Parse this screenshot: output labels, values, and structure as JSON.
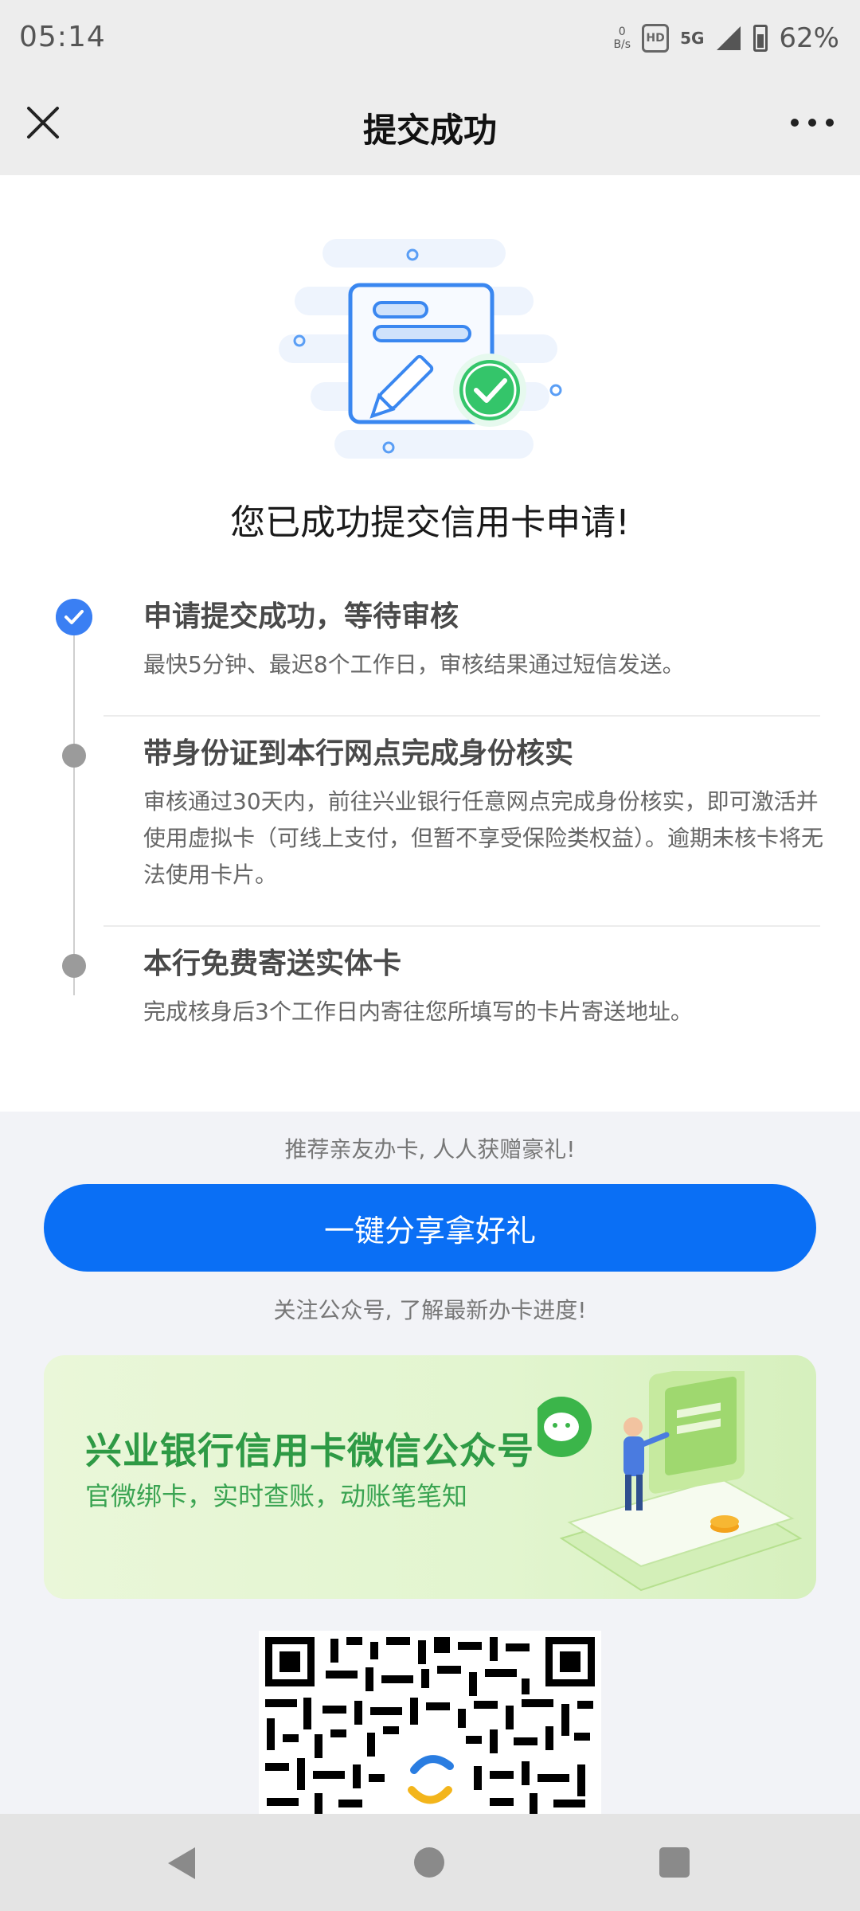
{
  "status_bar": {
    "time": "05:14",
    "net_speed_value": "0",
    "net_speed_unit": "B/s",
    "hd_label": "HD",
    "network": "5G",
    "battery": "62%"
  },
  "nav": {
    "title": "提交成功",
    "close_icon": "close-icon",
    "more_icon": "more-icon"
  },
  "success_message": "您已成功提交信用卡申请!",
  "steps": [
    {
      "title": "申请提交成功，等待审核",
      "desc": "最快5分钟、最迟8个工作日，审核结果通过短信发送。",
      "status": "done"
    },
    {
      "title": "带身份证到本行网点完成身份核实",
      "desc": "审核通过30天内，前往兴业银行任意网点完成身份核实，即可激活并使用虚拟卡（可线上支付，但暂不享受保险类权益）。逾期未核卡将无法使用卡片。",
      "status": "pending"
    },
    {
      "title": "本行免费寄送实体卡",
      "desc": "完成核身后3个工作日内寄往您所填写的卡片寄送地址。",
      "status": "pending"
    }
  ],
  "recommend_text": "推荐亲友办卡, 人人获赠豪礼!",
  "share_button": "一键分享拿好礼",
  "follow_text": "关注公众号, 了解最新办卡进度!",
  "banner": {
    "title": "兴业银行信用卡微信公众号",
    "subtitle": "官微绑卡，实时查账，动账笔笔知"
  },
  "colors": {
    "primary_blue": "#0a6ff5",
    "check_blue": "#3a7ff3",
    "success_green": "#34c56a",
    "banner_green": "#2e9a45"
  }
}
